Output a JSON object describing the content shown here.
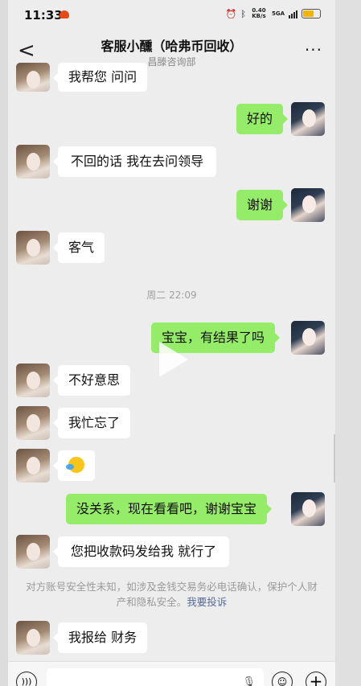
{
  "status_bar": {
    "time": "11:33",
    "net_speed": "0.40 KB/s",
    "network": "5GA"
  },
  "header": {
    "back_label": "<",
    "title": "客服小醺（哈弗币回收）",
    "subtitle": "昌滕咨询部",
    "more_label": "···"
  },
  "messages": [
    {
      "side": "left",
      "text": "我帮您 问问"
    },
    {
      "side": "right",
      "text": "好的"
    },
    {
      "side": "left",
      "text": "不回的话 我在去问领导"
    },
    {
      "side": "right",
      "text": "谢谢"
    },
    {
      "side": "left",
      "text": "客气"
    },
    {
      "side": "right",
      "text": "宝宝，有结果了吗"
    },
    {
      "side": "left",
      "text": "不好意思"
    },
    {
      "side": "left",
      "text": "我忙忘了"
    },
    {
      "side": "left",
      "text": ""
    },
    {
      "side": "right",
      "text": "没关系，现在看看吧，谢谢宝宝"
    },
    {
      "side": "left",
      "text": "您把收款码发给我 就行了"
    },
    {
      "side": "left",
      "text": "我报给 财务"
    }
  ],
  "timestamp": "周二 22:09",
  "notice": {
    "text": "对方账号安全性未知，如涉及金钱交易务必电话确认，保护个人财产和隐私安全。",
    "link": "我要投诉"
  }
}
